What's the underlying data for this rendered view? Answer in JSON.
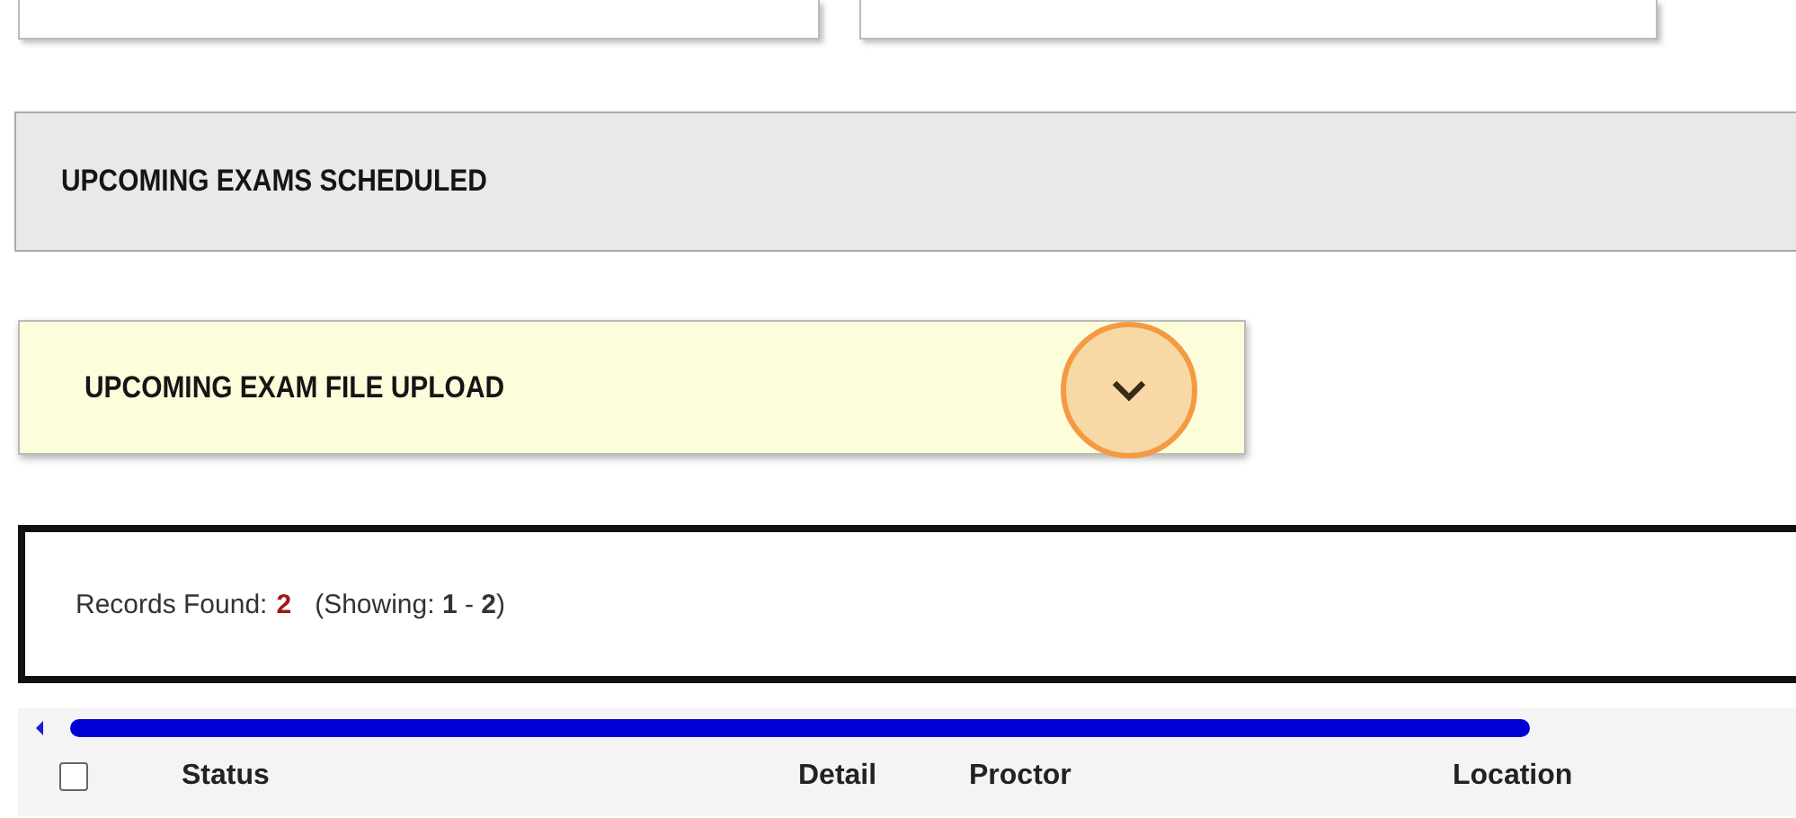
{
  "sections": [
    {
      "title": "UPCOMING EXAMS SCHEDULED",
      "kind": "plain"
    },
    {
      "title": "UPCOMING EXAM FILE UPLOAD",
      "kind": "highlighted",
      "expanded": false
    }
  ],
  "records": {
    "label": "Records Found:",
    "count": "2",
    "showing": "(Showing: **1** - **2**)"
  },
  "table": {
    "select_all": {
      "checked": false
    },
    "columns": [
      "Status",
      "Detail",
      "Proctor",
      "Location"
    ]
  }
}
